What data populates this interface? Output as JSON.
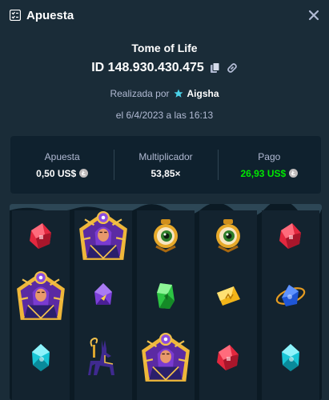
{
  "header": {
    "title": "Apuesta",
    "icon": "clipboard-list-icon",
    "close_icon": "close-icon"
  },
  "bet": {
    "game_name": "Tome of Life",
    "id_text": "ID 148.930.430.475",
    "placed_by_label": "Realizada por",
    "user": "Aigsha",
    "date_text": "el 6/4/2023 a las 16:13"
  },
  "stats": {
    "bet_label": "Apuesta",
    "bet_value": "0,50 US$",
    "multiplier_label": "Multiplicador",
    "multiplier_value": "53,85×",
    "payout_label": "Pago",
    "payout_value": "26,93 US$",
    "currency_icon": "litecoin-icon"
  },
  "colors": {
    "background": "#1a2c38",
    "panel": "#0f212e",
    "muted_text": "#b1bad3",
    "payout_green": "#00e701",
    "vip_star": "#4ad2e8"
  },
  "board": {
    "reels": [
      [
        "red-gem",
        "book-priestess",
        "cyan-gem"
      ],
      [
        "book-priestess",
        "purple-gem",
        "anubis-jackal"
      ],
      [
        "eye-amulet",
        "green-gem",
        "book-priestess"
      ],
      [
        "eye-amulet",
        "yellow-gem",
        "red-gem"
      ],
      [
        "red-gem",
        "blue-scarab",
        "cyan-gem"
      ]
    ]
  }
}
